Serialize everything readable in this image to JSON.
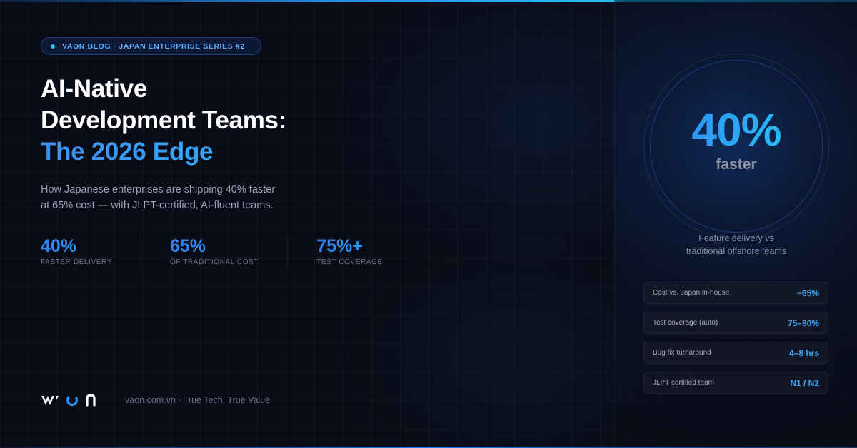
{
  "badge": {
    "text": "VAON BLOG · JAPAN ENTERPRISE SERIES #2"
  },
  "headline": {
    "line1": "AI-Native",
    "line2": "Development Teams:",
    "line3": "The 2026 Edge"
  },
  "subtitle": {
    "line1": "How Japanese enterprises are shipping 40% faster",
    "line2": "at 65% cost — with JLPT-certified, AI-fluent teams."
  },
  "stats": [
    {
      "value": "40%",
      "label": "FASTER DELIVERY"
    },
    {
      "value": "65%",
      "label": "OF TRADITIONAL COST"
    },
    {
      "value": "75%+",
      "label": "TEST COVERAGE"
    }
  ],
  "footer": {
    "text": "vaon.com.vn · True Tech, True Value"
  },
  "highlight": {
    "value": "40%",
    "unit": "faster",
    "caption_line1": "Feature delivery vs",
    "caption_line2": "traditional offshore teams"
  },
  "metrics": [
    {
      "label": "Cost vs. Japan in-house",
      "value": "−65%"
    },
    {
      "label": "Test coverage (auto)",
      "value": "75–90%"
    },
    {
      "label": "Bug fix turnaround",
      "value": "4–8 hrs"
    },
    {
      "label": "JLPT certified team",
      "value": "N1 / N2"
    }
  ],
  "colors": {
    "background": "#090c17",
    "accent_blue": "#2f7ff0",
    "accent_cyan": "#27c6f3",
    "badge_text": "#5fb0ff"
  },
  "icons": {
    "logo": "vaon-logo-icon"
  }
}
